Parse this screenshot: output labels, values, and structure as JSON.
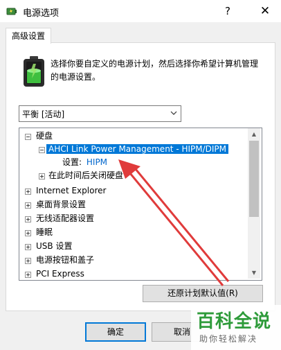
{
  "window": {
    "title": "电源选项",
    "help_glyph": "?",
    "close_glyph": "✕"
  },
  "tabs": [
    {
      "label": "高级设置"
    }
  ],
  "description": "选择你要自定义的电源计划，然后选择你希望计算机管理的电源设置。",
  "plan_dropdown": {
    "value": "平衡 [活动]"
  },
  "tree": {
    "hard_disk": "硬盘",
    "ahci": "AHCI Link Power Management - HIPM/DIPM",
    "setting_label": "设置:",
    "setting_value": "HIPM",
    "turn_off_after": "在此时间后关闭硬盘",
    "internet_explorer": "Internet Explorer",
    "desktop_background": "桌面背景设置",
    "wireless_adapter": "无线适配器设置",
    "sleep": "睡眠",
    "usb": "USB 设置",
    "power_buttons": "电源按钮和盖子",
    "pci_express": "PCI Express"
  },
  "buttons": {
    "restore_defaults": "还原计划默认值(R)",
    "ok": "确定",
    "cancel": "取消"
  },
  "watermark": {
    "brand": "百科全说",
    "slogan": "助你轻松解决"
  },
  "colors": {
    "selection": "#0078d7",
    "arrow": "#e03b3b",
    "watermark_green": "#2e9b3a"
  }
}
